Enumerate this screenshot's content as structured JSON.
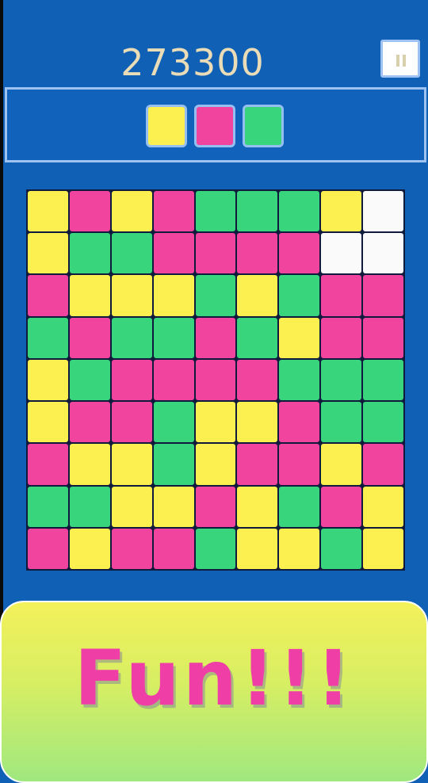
{
  "score": "273300",
  "banner_text": "Fun!!!",
  "colors": {
    "Y": "#fcef50",
    "P": "#f1449f",
    "G": "#38d57c",
    "W": "#fafafa"
  },
  "next_blocks": [
    "Y",
    "P",
    "G"
  ],
  "board": [
    [
      "Y",
      "P",
      "Y",
      "P",
      "G",
      "G",
      "G",
      "Y",
      "W"
    ],
    [
      "Y",
      "G",
      "G",
      "P",
      "P",
      "P",
      "P",
      "W",
      "W"
    ],
    [
      "P",
      "Y",
      "Y",
      "Y",
      "G",
      "Y",
      "G",
      "P",
      "P"
    ],
    [
      "G",
      "P",
      "G",
      "G",
      "P",
      "G",
      "Y",
      "P",
      "P"
    ],
    [
      "Y",
      "G",
      "P",
      "P",
      "P",
      "P",
      "G",
      "G",
      "G"
    ],
    [
      "Y",
      "P",
      "P",
      "G",
      "Y",
      "Y",
      "P",
      "G",
      "G"
    ],
    [
      "P",
      "Y",
      "Y",
      "G",
      "Y",
      "P",
      "P",
      "Y",
      "P"
    ],
    [
      "G",
      "G",
      "Y",
      "Y",
      "P",
      "Y",
      "G",
      "P",
      "Y"
    ],
    [
      "P",
      "Y",
      "P",
      "P",
      "G",
      "Y",
      "Y",
      "G",
      "Y"
    ]
  ]
}
